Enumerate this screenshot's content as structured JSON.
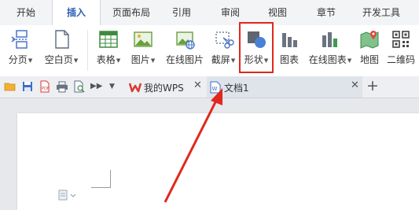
{
  "menu_tabs": [
    {
      "label": "开始"
    },
    {
      "label": "插入",
      "active": true
    },
    {
      "label": "页面布局"
    },
    {
      "label": "引用"
    },
    {
      "label": "审阅"
    },
    {
      "label": "视图"
    },
    {
      "label": "章节"
    },
    {
      "label": "开发工具"
    }
  ],
  "ribbon": {
    "page_break": "分页",
    "blank_page": "空白页",
    "table": "表格",
    "picture": "图片",
    "online_picture": "在线图片",
    "screenshot": "截屏",
    "shapes": "形状",
    "chart": "图表",
    "online_chart": "在线图表",
    "map": "地图",
    "qrcode": "二维码"
  },
  "doc_tabs": {
    "wps_home": "我的WPS",
    "document": "文档1"
  },
  "annotation": {
    "highlight_color": "#e0281e",
    "highlighted_button": "形状"
  },
  "icons": [
    "page-break-icon",
    "blank-page-icon",
    "table-icon",
    "picture-icon",
    "online-picture-icon",
    "screenshot-icon",
    "shapes-icon",
    "chart-icon",
    "online-chart-icon",
    "map-icon",
    "qrcode-icon",
    "open-icon",
    "save-icon",
    "pdf-icon",
    "print-icon",
    "preview-icon",
    "more-icon",
    "wps-logo-icon",
    "doc-icon",
    "plus-icon",
    "red-arrow"
  ]
}
